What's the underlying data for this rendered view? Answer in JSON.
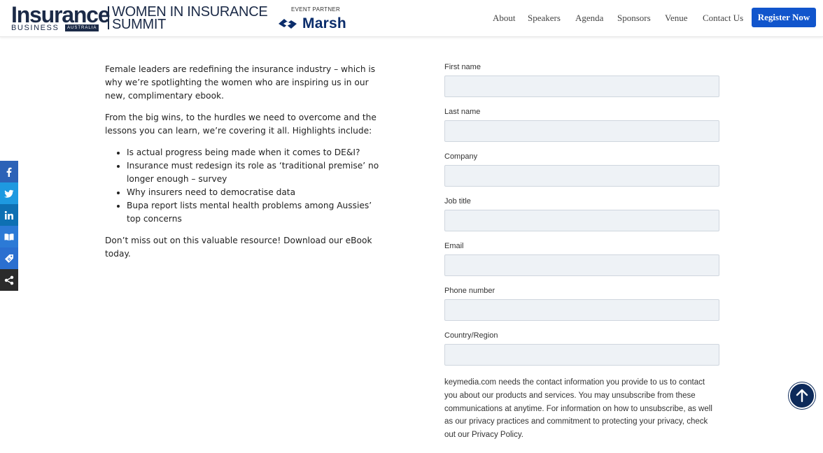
{
  "header": {
    "logo": {
      "insurance": "Insurance",
      "business": "BUSINESS",
      "country": "AUSTRALIA"
    },
    "summit_title_line1": "WOMEN IN INSURANCE",
    "summit_title_line2": "SUMMIT",
    "partner_label": "EVENT PARTNER",
    "partner_name": "Marsh",
    "nav": [
      "About",
      "Speakers",
      "Agenda",
      "Sponsors",
      "Venue",
      "Contact Us"
    ],
    "register_label": "Register Now",
    "brand_color": "#1155cc"
  },
  "content": {
    "intro": "Female leaders are redefining the insurance industry – which is why we’re spotlighting the women who are inspiring us in our new, complimentary ebook.",
    "lead": "From the big wins, to the hurdles we need to overcome and the lessons you can learn, we’re covering it all. Highlights include:",
    "highlights": [
      "Is actual progress being made when it comes to DE&I?",
      "Insurance must redesign its role as ‘traditional premise’ no longer enough – survey",
      "Why insurers need to democratise data",
      "Bupa report lists mental health problems among Aussies’ top concerns"
    ],
    "cta": "Don’t miss out on this valuable resource! Download our eBook today."
  },
  "social": [
    "facebook-icon",
    "twitter-icon",
    "linkedin-icon",
    "book-icon",
    "tag-icon",
    "share-icon"
  ],
  "form": {
    "fields": [
      {
        "label": "First name",
        "value": ""
      },
      {
        "label": "Last name",
        "value": ""
      },
      {
        "label": "Company",
        "value": ""
      },
      {
        "label": "Job title",
        "value": ""
      },
      {
        "label": "Email",
        "value": ""
      },
      {
        "label": "Phone number",
        "value": ""
      },
      {
        "label": "Country/Region",
        "value": ""
      }
    ],
    "disclaimer": "keymedia.com needs the contact information you provide to us to contact you about our products and services. You may unsubscribe from these communications at anytime. For information on how to unsubscribe, as well as our privacy practices and commitment to protecting your privacy, check out our Privacy Policy."
  },
  "scroll_top_icon": "arrow-up-icon"
}
